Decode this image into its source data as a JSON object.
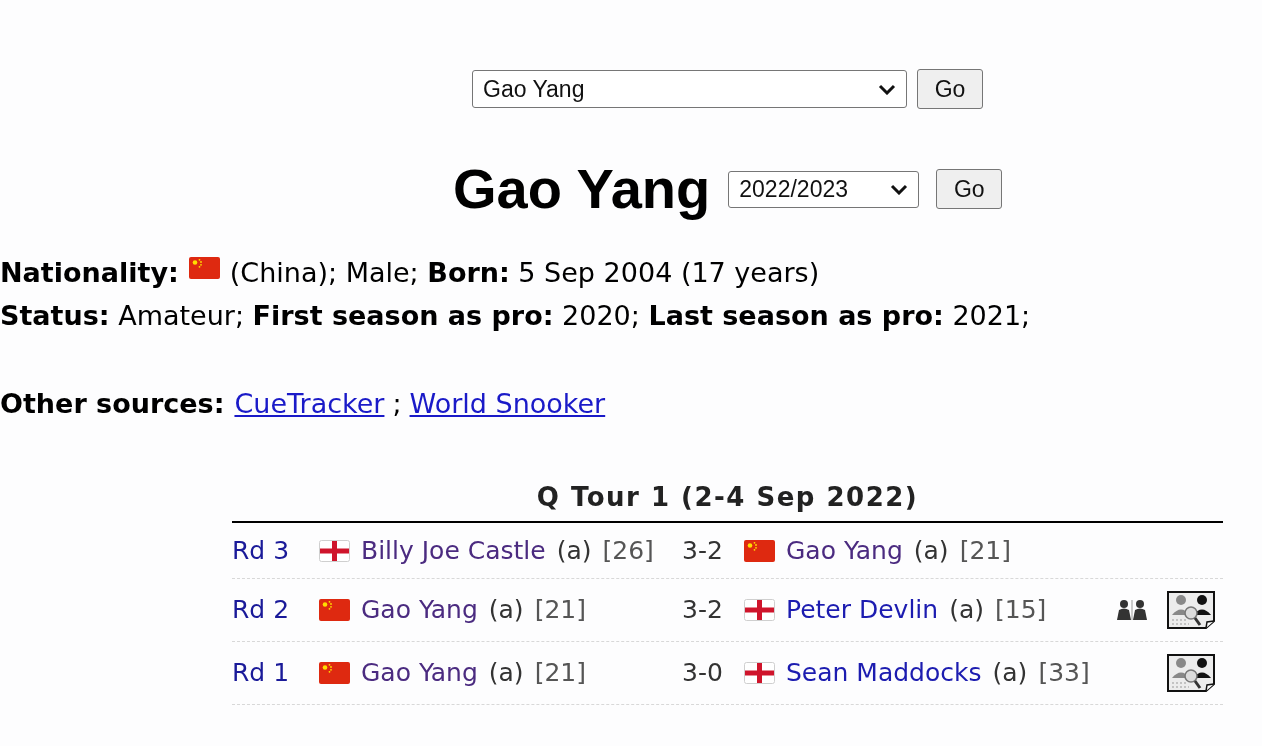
{
  "player_picker": {
    "value": "Gao Yang",
    "button": "Go"
  },
  "heading": {
    "title": "Gao Yang",
    "season_value": "2022/2023",
    "button": "Go"
  },
  "profile": {
    "nationality_label": "Nationality:",
    "flag": {
      "kind": "china"
    },
    "nationality_rest": "(China); Male; **Born:** 5 Sep 2004 (17 years)",
    "status_line": "**Status:** Amateur; **First season as pro:** 2020; **Last season as pro:** 2021;"
  },
  "other_sources": {
    "label": "Other sources:",
    "links": [
      {
        "text": "CueTracker"
      },
      {
        "text": "World Snooker"
      }
    ],
    "separator": ";"
  },
  "tournament": {
    "title": "Q Tour 1 (2-4 Sep 2022)",
    "matches": [
      {
        "round": "Rd 3",
        "player_1": {
          "flag": {
            "kind": "england"
          },
          "name": "Billy Joe Castle",
          "visited": true,
          "status": "(a)",
          "rank": "[26]"
        },
        "score": "3-2",
        "player_2": {
          "flag": {
            "kind": "china"
          },
          "name": "Gao Yang",
          "visited": true,
          "status": "(a)",
          "rank": "[21]"
        },
        "head_to_head": false,
        "frame_details": false
      },
      {
        "round": "Rd 2",
        "player_1": {
          "flag": {
            "kind": "china"
          },
          "name": "Gao Yang",
          "visited": true,
          "status": "(a)",
          "rank": "[21]"
        },
        "score": "3-2",
        "player_2": {
          "flag": {
            "kind": "england"
          },
          "name": "Peter Devlin",
          "visited": false,
          "status": "(a)",
          "rank": "[15]"
        },
        "head_to_head": true,
        "frame_details": true
      },
      {
        "round": "Rd 1",
        "player_1": {
          "flag": {
            "kind": "china"
          },
          "name": "Gao Yang",
          "visited": true,
          "status": "(a)",
          "rank": "[21]"
        },
        "score": "3-0",
        "player_2": {
          "flag": {
            "kind": "england"
          },
          "name": "Sean Maddocks",
          "visited": false,
          "status": "(a)",
          "rank": "[33]"
        },
        "head_to_head": false,
        "frame_details": true
      }
    ]
  }
}
